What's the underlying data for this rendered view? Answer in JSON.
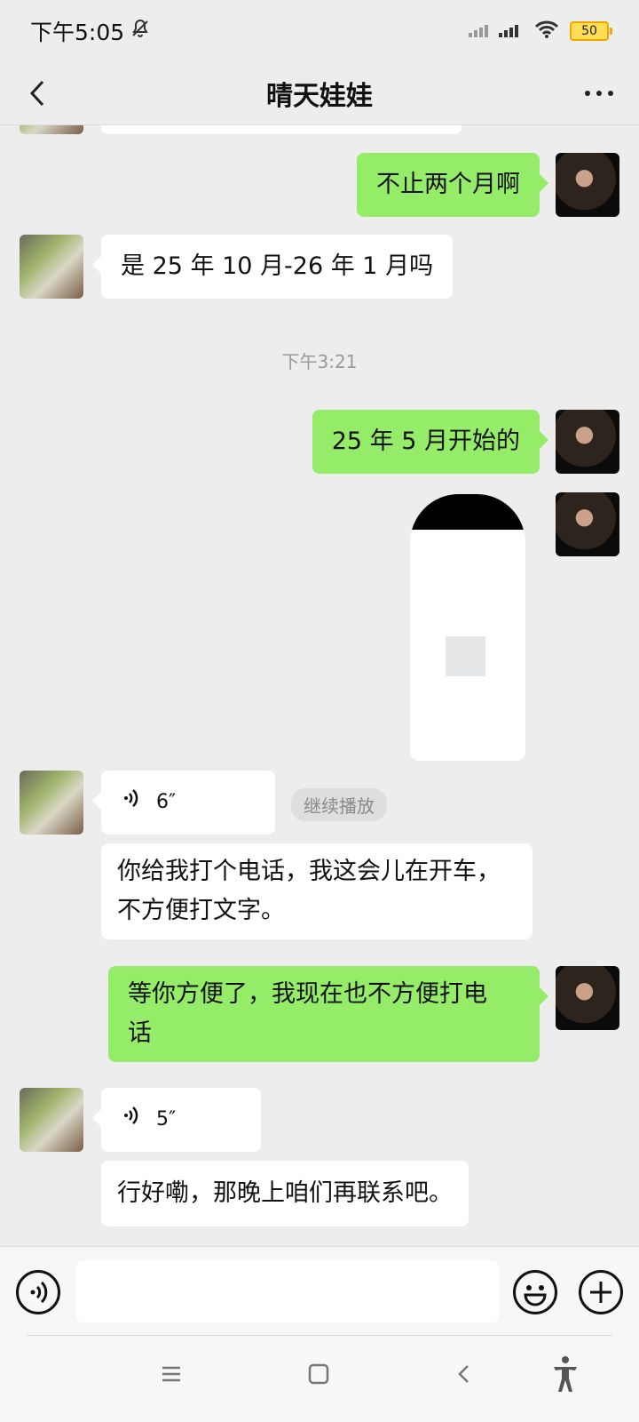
{
  "status_bar": {
    "time": "下午5:05",
    "battery": "50"
  },
  "header": {
    "title": "晴天娃娃"
  },
  "messages": {
    "m1": "不止两个月啊",
    "m2": "是 25 年 10 月-26 年 1 月吗",
    "time_divider": "下午3:21",
    "m3": "25 年 5 月开始的",
    "voice1_duration": "6″",
    "replay_label": "继续播放",
    "m4_line1": "你给我打个电话，我这会儿在开车，",
    "m4_line2": "不方便打文字。",
    "m5_line1": "等你方便了，我现在也不方便打电",
    "m5_line2": "话",
    "voice2_duration": "5″",
    "m6": "行好嘞，那晚上咱们再联系吧。"
  },
  "composer": {
    "placeholder": ""
  },
  "colors": {
    "background": "#ededed",
    "my_bubble": "#95ec69",
    "friend_bubble": "#ffffff"
  },
  "icons": {
    "status": [
      "mute-bell-icon",
      "signal-icon",
      "wifi-icon",
      "battery-icon"
    ],
    "header": [
      "back-chevron-icon",
      "more-icon"
    ],
    "composer": [
      "voice-input-icon",
      "emoji-icon",
      "plus-icon"
    ],
    "system_nav": [
      "menu-icon",
      "home-icon",
      "back-icon",
      "accessibility-icon"
    ]
  }
}
